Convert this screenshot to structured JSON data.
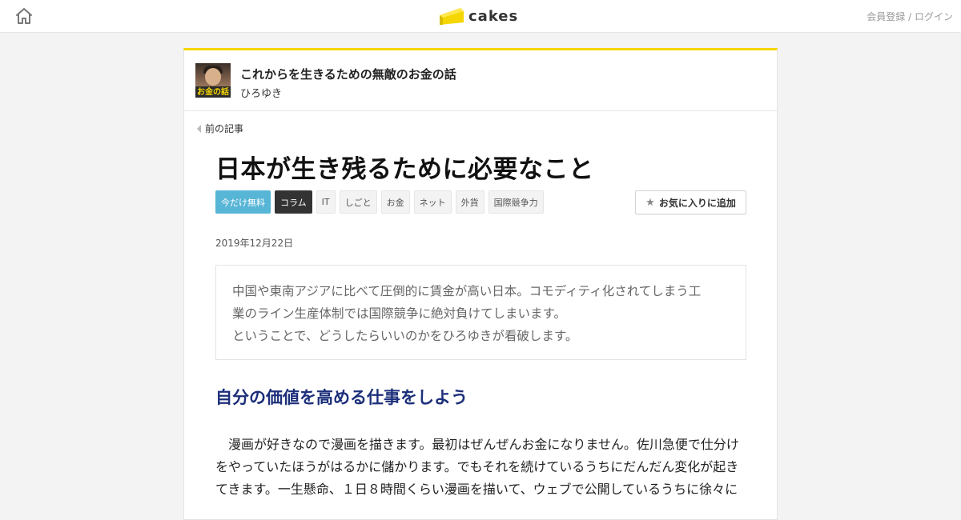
{
  "header": {
    "home_icon": "home-icon",
    "logo_text": "cakes",
    "brand_color": "#f5d600",
    "register_label": "会員登録",
    "separator": "/",
    "login_label": "ログイン"
  },
  "series": {
    "thumbnail_caption": "お金の話",
    "title": "これからを生きるための無敵のお金の話",
    "author": "ひろゆき"
  },
  "nav": {
    "prev_label": "前の記事"
  },
  "article": {
    "title": "日本が生き残るために必要なこと",
    "tags": [
      "今だけ無料",
      "コラム",
      "IT",
      "しごと",
      "お金",
      "ネット",
      "外貨",
      "国際競争力"
    ],
    "favorite_label": "お気に入りに追加",
    "date": "2019年12月22日",
    "lead_lines": [
      "中国や東南アジアに比べて圧倒的に賃金が高い日本。コモディティ化されてしまう工",
      "業のライン生産体制では国際競争に絶対負けてしまいます。",
      "ということで、どうしたらいいのかをひろゆきが看破します。"
    ],
    "section_heading": "自分の価値を高める仕事をしよう",
    "body_lines": [
      "　漫画が好きなので漫画を描きます。最初はぜんぜんお金になりません。佐川急便で仕分け",
      "をやっていたほうがはるかに儲かります。でもそれを続けているうちにだんだん変化が起き",
      "てきます。一生懸命、１日８時間くらい漫画を描いて、ウェブで公開しているうちに徐々に"
    ]
  }
}
